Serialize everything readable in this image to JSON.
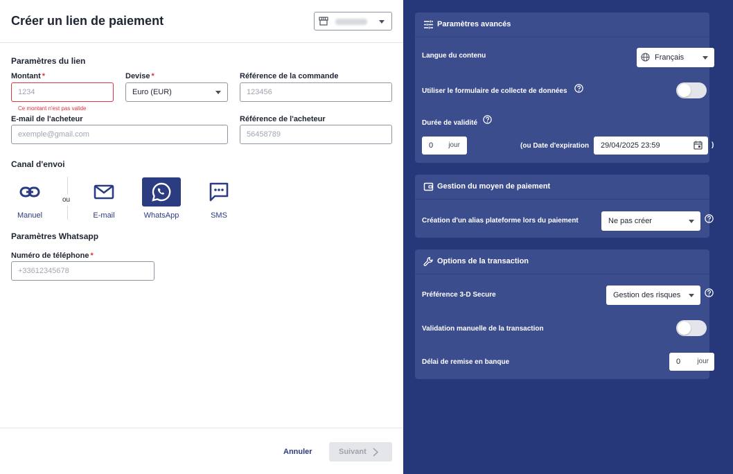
{
  "header": {
    "title": "Créer un lien de paiement",
    "shop_icon": "store-icon"
  },
  "link_params": {
    "section": "Paramètres du lien",
    "amount_label": "Montant",
    "amount_placeholder": "1234",
    "amount_error": "Ce montant n'est pas valide",
    "currency_label": "Devise",
    "currency_value": "Euro (EUR)",
    "order_ref_label": "Référence de la commande",
    "order_ref_placeholder": "123456",
    "buyer_email_label": "E-mail de l'acheteur",
    "buyer_email_placeholder": "exemple@gmail.com",
    "buyer_ref_label": "Référence de l'acheteur",
    "buyer_ref_placeholder": "56458789",
    "required_mark": "*"
  },
  "channel": {
    "section": "Canal d'envoi",
    "or_text": "ou",
    "items": [
      {
        "label": "Manuel",
        "icon": "link-icon"
      },
      {
        "label": "E-mail",
        "icon": "mail-icon"
      },
      {
        "label": "WhatsApp",
        "icon": "whatsapp-icon",
        "active": true
      },
      {
        "label": "SMS",
        "icon": "sms-icon"
      }
    ]
  },
  "whatsapp": {
    "section": "Paramètres Whatsapp",
    "phone_label": "Numéro de téléphone",
    "phone_placeholder": "+33612345678"
  },
  "footer": {
    "cancel": "Annuler",
    "next": "Suivant"
  },
  "advanced": {
    "title": "Paramètres avancés",
    "icon": "sliders-icon",
    "language_label": "Langue du contenu",
    "language_value": "Français",
    "form_label": "Utiliser le formulaire de collecte de données",
    "form_enabled": false,
    "validity_label": "Durée de validité",
    "validity_days": "0",
    "validity_unit": "jour",
    "expiry_prefix": "(ou Date d'expiration",
    "expiry_value": "29/04/2025 23:59",
    "expiry_suffix": ")"
  },
  "payment_method": {
    "title": "Gestion du moyen de paiement",
    "icon": "wallet-icon",
    "alias_label": "Création d'un alias plateforme lors du paiement",
    "alias_value": "Ne pas créer"
  },
  "transaction": {
    "title": "Options de la transaction",
    "icon": "wrench-icon",
    "secure_label": "Préférence 3-D Secure",
    "secure_value": "Gestion des risques",
    "manual_label": "Validation manuelle de la transaction",
    "manual_enabled": false,
    "delay_label": "Délai de remise en banque",
    "delay_value": "0",
    "delay_unit": "jour"
  },
  "colors": {
    "primary": "#2b3d80",
    "panel_bg": "#27387a",
    "card_bg": "#3c4d8e",
    "error": "#e0313c"
  }
}
